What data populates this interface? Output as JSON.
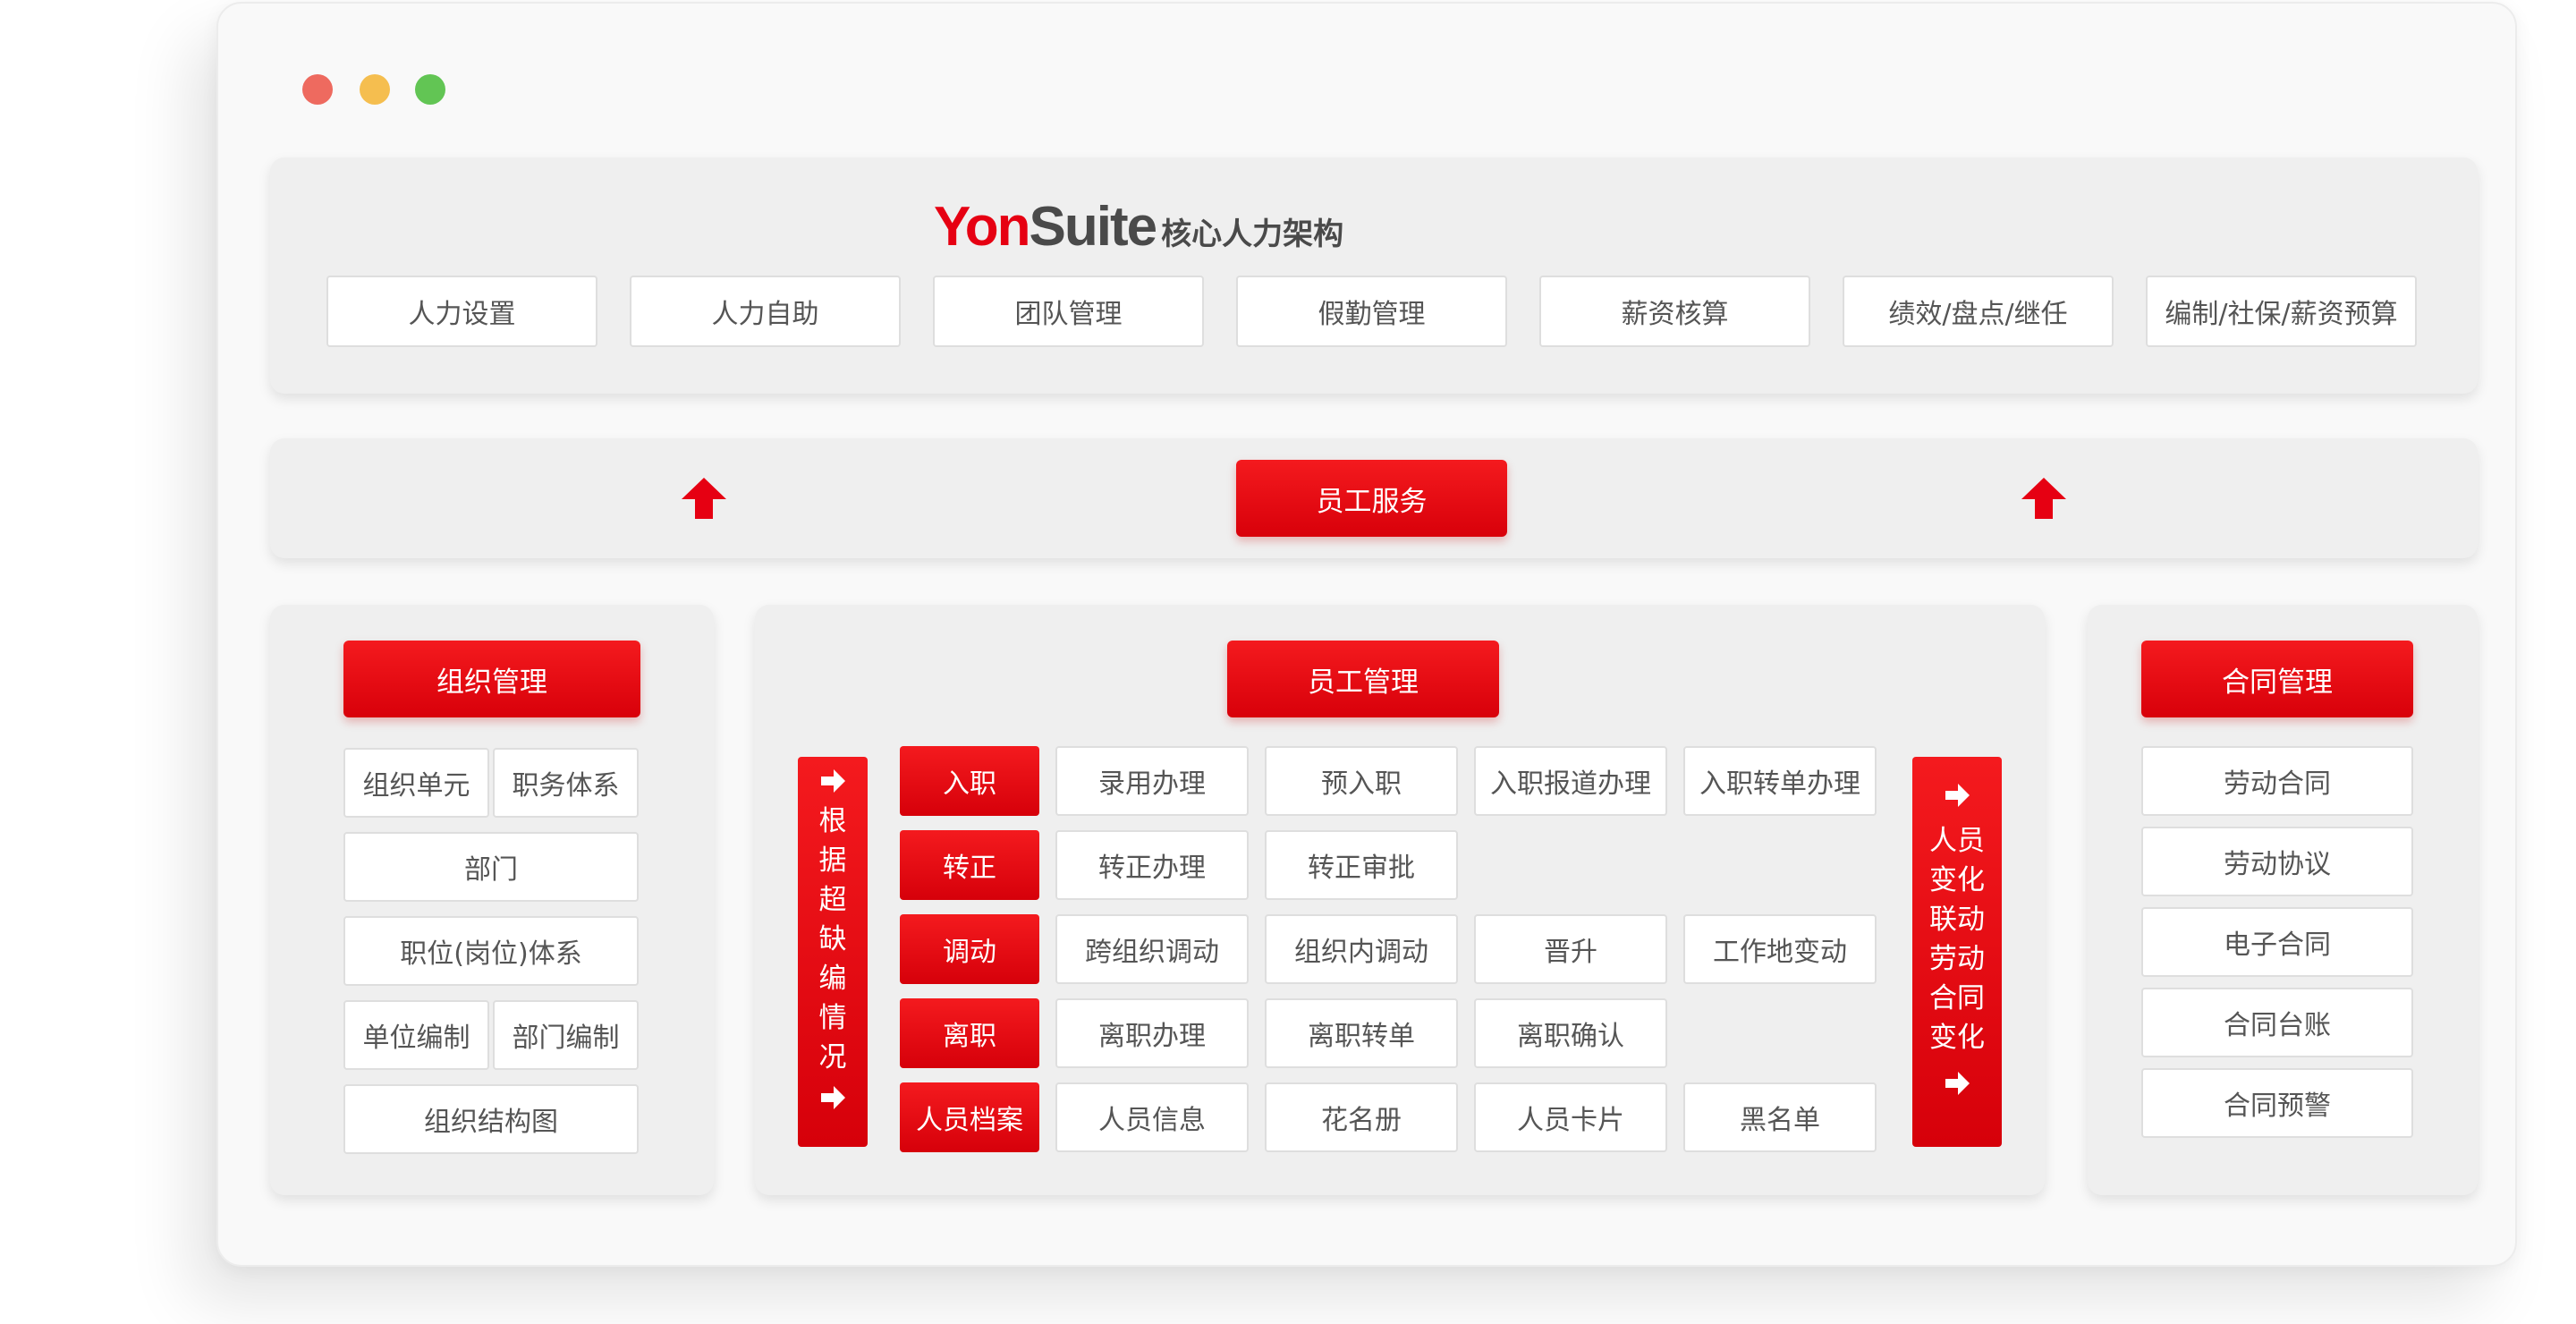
{
  "header": {
    "brand_red": "Yon",
    "brand_dark": "Suite",
    "subtitle": "核心人力架构",
    "items": [
      "人力设置",
      "人力自助",
      "团队管理",
      "假勤管理",
      "薪资核算",
      "绩效/盘点/继任",
      "编制/社保/薪资预算"
    ]
  },
  "service": {
    "label": "员工服务",
    "arrow_icon": "up-arrow-icon"
  },
  "org": {
    "title": "组织管理",
    "items": [
      "组织单元",
      "职务体系",
      "部门",
      "职位(岗位)体系",
      "单位编制",
      "部门编制",
      "组织结构图"
    ]
  },
  "employee": {
    "title": "员工管理",
    "left_bar": [
      "根",
      "据",
      "超",
      "缺",
      "编",
      "情",
      "况"
    ],
    "right_bar": [
      "人员",
      "变化",
      "联动",
      "劳动",
      "合同",
      "变化"
    ],
    "rows": [
      {
        "tag": "入职",
        "items": [
          "录用办理",
          "预入职",
          "入职报道办理",
          "入职转单办理"
        ]
      },
      {
        "tag": "转正",
        "items": [
          "转正办理",
          "转正审批"
        ]
      },
      {
        "tag": "调动",
        "items": [
          "跨组织调动",
          "组织内调动",
          "晋升",
          "工作地变动"
        ]
      },
      {
        "tag": "离职",
        "items": [
          "离职办理",
          "离职转单",
          "离职确认"
        ]
      },
      {
        "tag": "人员档案",
        "items": [
          "人员信息",
          "花名册",
          "人员卡片",
          "黑名单"
        ]
      }
    ]
  },
  "contract": {
    "title": "合同管理",
    "items": [
      "劳动合同",
      "劳动协议",
      "电子合同",
      "合同台账",
      "合同预警"
    ]
  },
  "colors": {
    "accent": "#e60012",
    "panel": "#efefef",
    "window": "#f9f9f9"
  }
}
